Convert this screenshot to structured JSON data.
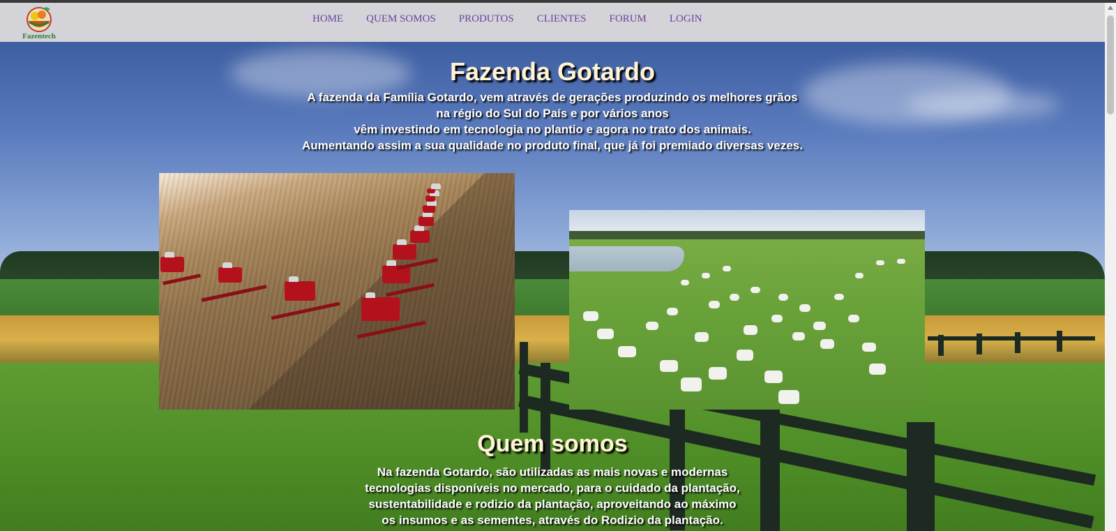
{
  "brand": {
    "name": "Fazentech",
    "logo": "fruit-basket-logo"
  },
  "nav": {
    "items": [
      "HOME",
      "QUEM SOMOS",
      "PRODUTOS",
      "CLIENTES",
      "FORUM",
      "LOGIN"
    ]
  },
  "hero": {
    "title": "Fazenda Gotardo",
    "intro_lines": [
      "A fazenda da Família Gotardo, vem através de gerações produzindo os melhores grãos",
      "na régio do Sul do País e por vários anos",
      "vêm investindo em tecnologia no plantio e agora no trato dos animais.",
      "Aumentando assim a sua qualidade no produto final, que já foi premiado diversas vezes."
    ]
  },
  "about": {
    "title": "Quem somos",
    "lines": [
      "Na fazenda Gotardo, são utilizadas as mais novas e modernas",
      "tecnologias disponíveis no mercado, para o cuidado da plantação,",
      "sustentabilidade e rodizio da plantação, aproveitando ao máximo",
      "os insumos e as sementes, através do Rodizio da plantação."
    ]
  },
  "colors": {
    "nav_bg": "#d4d4d8",
    "nav_link": "#6b3fa0",
    "title": "#fff3d6",
    "text": "#ffffff"
  }
}
